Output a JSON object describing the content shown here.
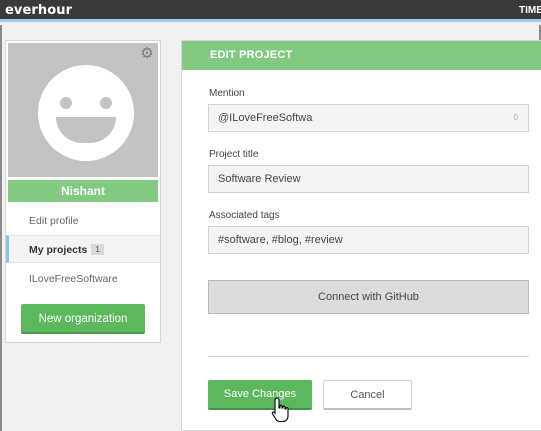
{
  "app": {
    "logo": "everhour",
    "top_nav": "TIME"
  },
  "sidebar": {
    "user_name": "Nishant",
    "items": [
      {
        "label": "Edit profile"
      },
      {
        "label": "My projects",
        "count": "1"
      },
      {
        "label": "ILoveFreeSoftware"
      }
    ],
    "new_org_label": "New organization"
  },
  "edit_project": {
    "header": "EDIT PROJECT",
    "mention_label": "Mention",
    "mention_value": "@ILoveFreeSoftwa",
    "mention_count": "0",
    "title_label": "Project title",
    "title_value": "Software Review",
    "tags_label": "Associated tags",
    "tags_value": "#software, #blog, #review",
    "github_label": "Connect with GitHub",
    "save_label": "Save Changes",
    "cancel_label": "Cancel"
  },
  "icons": {
    "settings": "gear-icon",
    "avatar": "smiley-avatar",
    "cursor": "hand-pointer-cursor"
  },
  "colors": {
    "topbar": "#3a3a3a",
    "accent_green": "#82c982",
    "button_green": "#5cb85c",
    "active_marker": "#82c9de"
  }
}
